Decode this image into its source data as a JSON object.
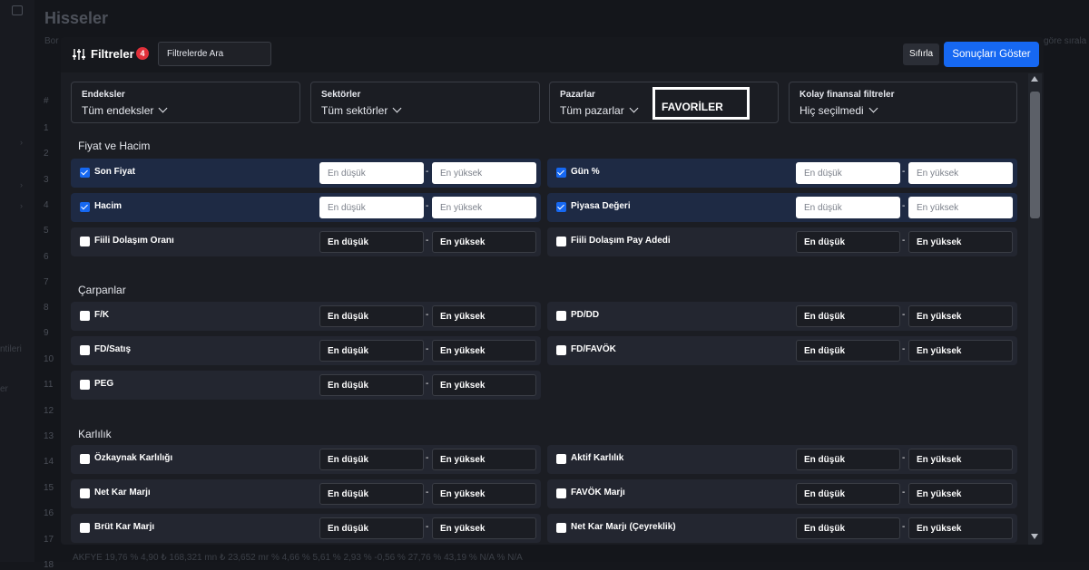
{
  "background": {
    "title": "Hisseler",
    "subtitle": "Bor",
    "right_text": "göre sırala",
    "side_texts": [
      "ntileri",
      "er"
    ],
    "row_numbers": [
      "#",
      "1",
      "2",
      "3",
      "4",
      "5",
      "6",
      "7",
      "8",
      "9",
      "10",
      "11",
      "12",
      "13",
      "14",
      "15",
      "16",
      "17",
      "18"
    ],
    "bottom_row": "AKFYE   19,76   % 4,90   ₺ 168,321 mn   ₺ 23,652 mr   % 4,66   % 5,61   % 2,93   % -0,56   % 27,76   % 43,19   % N/A   % N/A"
  },
  "header": {
    "title": "Filtreler",
    "badge_count": "4",
    "search_placeholder": "Filtrelerde Ara",
    "reset_label": "Sıfırla",
    "show_results_label": "Sonuçları Göster"
  },
  "dropdowns": [
    {
      "label": "Endeksler",
      "value": "Tüm endeksler"
    },
    {
      "label": "Sektörler",
      "value": "Tüm sektörler"
    },
    {
      "label": "Pazarlar",
      "value": "Tüm pazarlar"
    },
    {
      "label": "Kolay finansal filtreler",
      "value": "Hiç seçilmedi"
    }
  ],
  "favorites_label": "FAVORİLER",
  "range": {
    "min_placeholder": "En düşük",
    "max_placeholder": "En yüksek",
    "dash": "-"
  },
  "sections": [
    {
      "title": "Fiyat ve Hacim",
      "filters": [
        {
          "label": "Son Fiyat",
          "checked": true
        },
        {
          "label": "Gün %",
          "checked": true
        },
        {
          "label": "Hacim",
          "checked": true
        },
        {
          "label": "Piyasa Değeri",
          "checked": true
        },
        {
          "label": "Fiili Dolaşım Oranı",
          "checked": false
        },
        {
          "label": "Fiili Dolaşım Pay Adedi",
          "checked": false
        }
      ]
    },
    {
      "title": "Çarpanlar",
      "filters": [
        {
          "label": "F/K",
          "checked": false
        },
        {
          "label": "PD/DD",
          "checked": false
        },
        {
          "label": "FD/Satış",
          "checked": false
        },
        {
          "label": "FD/FAVÖK",
          "checked": false
        },
        {
          "label": "PEG",
          "checked": false
        }
      ]
    },
    {
      "title": "Karlılık",
      "filters": [
        {
          "label": "Özkaynak Karlılığı",
          "checked": false
        },
        {
          "label": "Aktif Karlılık",
          "checked": false
        },
        {
          "label": "Net Kar Marjı",
          "checked": false
        },
        {
          "label": "FAVÖK Marjı",
          "checked": false
        },
        {
          "label": "Brüt Kar Marjı",
          "checked": false
        },
        {
          "label": "Net Kar Marjı (Çeyreklik)",
          "checked": false
        }
      ]
    }
  ]
}
